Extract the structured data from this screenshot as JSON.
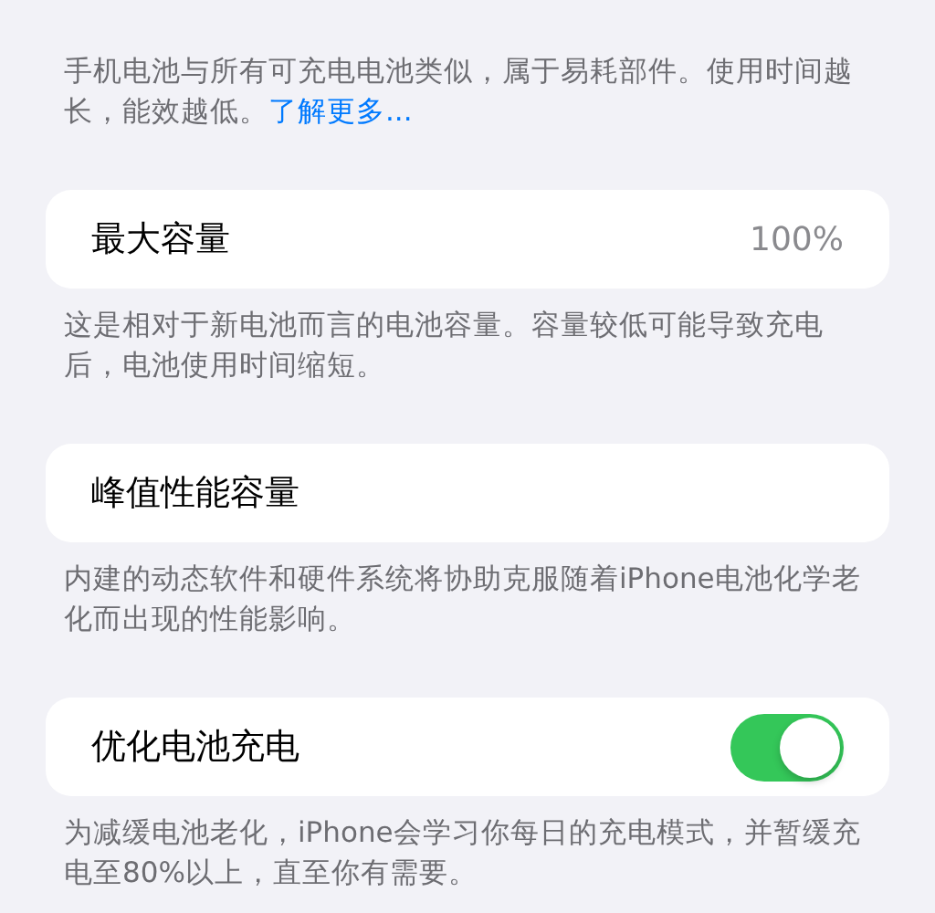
{
  "intro": {
    "text": "手机电池与所有可充电电池类似，属于易耗部件。使用时间越长，能效越低。",
    "link": "了解更多..."
  },
  "sections": [
    {
      "kind": "value",
      "label": "最大容量",
      "value": "100%",
      "footer": "这是相对于新电池而言的电池容量。容量较低可能导致充电后，电池使用时间缩短。"
    },
    {
      "kind": "plain",
      "label": "峰值性能容量",
      "footer": "内建的动态软件和硬件系统将协助克服随着iPhone电池化学老化而出现的性能影响。"
    },
    {
      "kind": "toggle",
      "label": "优化电池充电",
      "on": true,
      "footer": "为减缓电池老化，iPhone会学习你每日的充电模式，并暂缓充电至80%以上，直至你有需要。"
    }
  ]
}
